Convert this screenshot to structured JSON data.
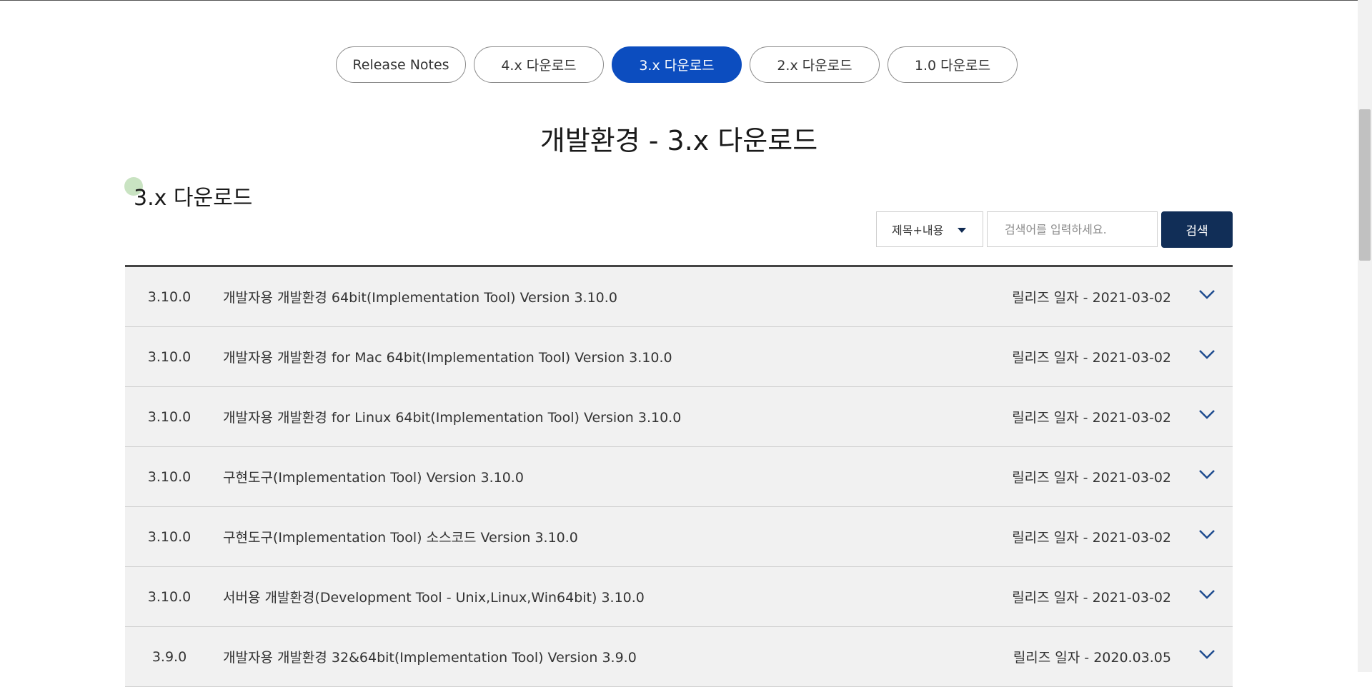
{
  "tabs": [
    {
      "label": "Release Notes",
      "active": false
    },
    {
      "label": "4.x 다운로드",
      "active": false
    },
    {
      "label": "3.x 다운로드",
      "active": true
    },
    {
      "label": "2.x 다운로드",
      "active": false
    },
    {
      "label": "1.0 다운로드",
      "active": false
    }
  ],
  "page_title": "개발환경 - 3.x 다운로드",
  "section_title": "3.x 다운로드",
  "search": {
    "select_value": "제목+내용",
    "placeholder": "검색어를 입력하세요.",
    "button_label": "검색"
  },
  "rows": [
    {
      "version": "3.10.0",
      "title": "개발자용 개발환경 64bit(Implementation Tool) Version 3.10.0",
      "date": "릴리즈 일자 - 2021-03-02"
    },
    {
      "version": "3.10.0",
      "title": "개발자용 개발환경 for Mac 64bit(Implementation Tool) Version 3.10.0",
      "date": "릴리즈 일자 - 2021-03-02"
    },
    {
      "version": "3.10.0",
      "title": "개발자용 개발환경 for Linux 64bit(Implementation Tool) Version 3.10.0",
      "date": "릴리즈 일자 - 2021-03-02"
    },
    {
      "version": "3.10.0",
      "title": "구현도구(Implementation Tool) Version 3.10.0",
      "date": "릴리즈 일자 - 2021-03-02"
    },
    {
      "version": "3.10.0",
      "title": "구현도구(Implementation Tool) 소스코드 Version 3.10.0",
      "date": "릴리즈 일자 - 2021-03-02"
    },
    {
      "version": "3.10.0",
      "title": "서버용 개발환경(Development Tool - Unix,Linux,Win64bit) 3.10.0",
      "date": "릴리즈 일자 - 2021-03-02"
    },
    {
      "version": "3.9.0",
      "title": "개발자용 개발환경 32&64bit(Implementation Tool) Version 3.9.0",
      "date": "릴리즈 일자 - 2020.03.05"
    }
  ],
  "colors": {
    "active_tab": "#0c4dbf",
    "search_button": "#112e57",
    "row_background": "#f1f1f1",
    "chevron": "#1f4c8f"
  },
  "icons": {
    "row_toggle": "chevron-down-icon",
    "select_toggle": "caret-down-icon"
  }
}
